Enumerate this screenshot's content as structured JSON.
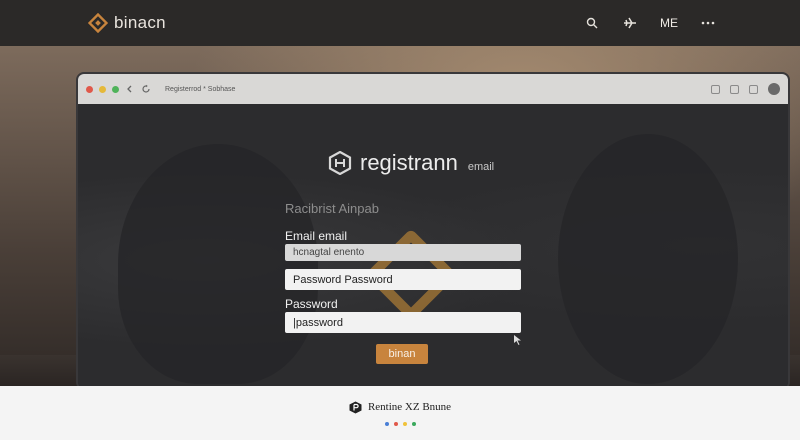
{
  "nav": {
    "brand": "binacn",
    "me_label": "ME"
  },
  "browser": {
    "tab_label": "Registerrod * Sobhase"
  },
  "page": {
    "title": "registrann",
    "title_suffix": "email",
    "form_heading": "Racibrist Ainpab",
    "email_label": "Email email",
    "email_value": "hcnagtal enento",
    "password_placeholder_field": "Password Password",
    "password_label": "Password",
    "password_value": "|password",
    "submit_label": "binan"
  },
  "footer": {
    "text": "Rentine XZ Bnune"
  },
  "colors": {
    "brand_orange": "#c8843d",
    "nav_bg": "#2b2928",
    "footer_dots": [
      "#4a7fd6",
      "#e0584a",
      "#f0c23a",
      "#3aa85c"
    ]
  },
  "icons": [
    "binance-logo-icon",
    "search-icon",
    "plane-icon",
    "more-icon",
    "back-icon",
    "reload-icon",
    "window-icon",
    "profile-circle-icon"
  ]
}
